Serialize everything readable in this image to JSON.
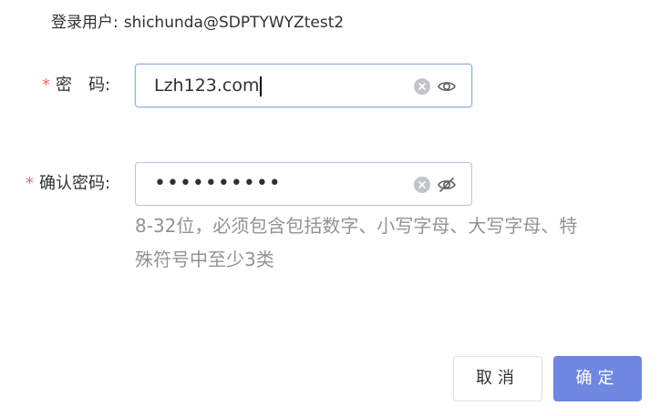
{
  "login_user": {
    "label": "登录用户:",
    "value": "shichunda@SDPTYWYZtest2"
  },
  "password": {
    "required_mark": "*",
    "label": "密　码:",
    "value": "Lzh123.com",
    "clear_icon": "clear-circle-icon",
    "toggle_icon": "eye-icon"
  },
  "confirm_password": {
    "required_mark": "*",
    "label": "确认密码:",
    "value": "••••••••••",
    "clear_icon": "clear-circle-icon",
    "toggle_icon": "eye-off-icon"
  },
  "hint": "8-32位，必须包含包括数字、小写字母、大写字母、特殊符号中至少3类",
  "buttons": {
    "cancel": "取消",
    "confirm": "确定"
  },
  "colors": {
    "required": "#f56c6c",
    "primary": "#6f87e0",
    "hint": "#909399"
  }
}
